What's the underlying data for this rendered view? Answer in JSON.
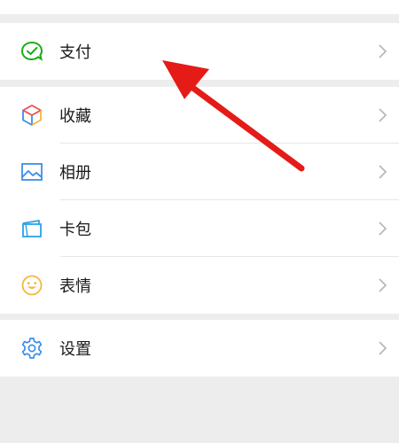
{
  "menu": {
    "pay": {
      "label": "支付",
      "icon": "pay-check-icon"
    },
    "items": [
      {
        "label": "收藏",
        "icon": "favorites-cube-icon"
      },
      {
        "label": "相册",
        "icon": "album-picture-icon"
      },
      {
        "label": "卡包",
        "icon": "card-wallet-icon"
      },
      {
        "label": "表情",
        "icon": "sticker-smiley-icon"
      }
    ],
    "settings": {
      "label": "设置",
      "icon": "settings-gear-icon"
    }
  },
  "colors": {
    "pay_green": "#1aad19",
    "album_blue": "#3d8ee8",
    "card_blue": "#2aa3e8",
    "smiley_yellow": "#f6b73a",
    "arrow_red": "#e41b17"
  }
}
